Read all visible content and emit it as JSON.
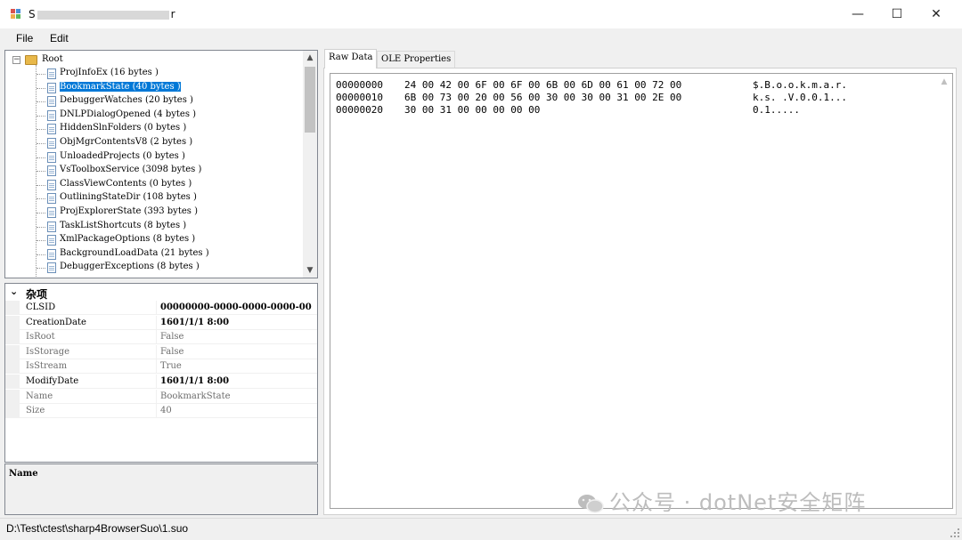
{
  "window": {
    "title_prefix": "S",
    "title_suffix": "r",
    "minimize": "—",
    "maximize": "☐",
    "close": "✕"
  },
  "menu": {
    "file": "File",
    "edit": "Edit"
  },
  "tree": {
    "root": "Root",
    "items": [
      {
        "label": "ProjInfoEx (16 bytes )"
      },
      {
        "label": "BookmarkState (40 bytes )"
      },
      {
        "label": "DebuggerWatches (20 bytes )"
      },
      {
        "label": "DNLPDialogOpened (4 bytes )"
      },
      {
        "label": "HiddenSlnFolders (0 bytes )"
      },
      {
        "label": "ObjMgrContentsV8 (2 bytes )"
      },
      {
        "label": "UnloadedProjects (0 bytes )"
      },
      {
        "label": "VsToolboxService (3098 bytes )"
      },
      {
        "label": "ClassViewContents (0 bytes )"
      },
      {
        "label": "OutliningStateDir (108 bytes )"
      },
      {
        "label": "ProjExplorerState (393 bytes )"
      },
      {
        "label": "TaskListShortcuts (8 bytes )"
      },
      {
        "label": "XmlPackageOptions (8 bytes )"
      },
      {
        "label": "BackgroundLoadData (21 bytes )"
      },
      {
        "label": "DebuggerExceptions (8 bytes )"
      }
    ],
    "selected": "BookmarkState (40 bytes )"
  },
  "properties": {
    "category": "杂项",
    "rows": [
      {
        "name": "CLSID",
        "value": "00000000-0000-0000-0000-00",
        "readonly": false
      },
      {
        "name": "CreationDate",
        "value": "1601/1/1 8:00",
        "readonly": false
      },
      {
        "name": "IsRoot",
        "value": "False",
        "readonly": true
      },
      {
        "name": "IsStorage",
        "value": "False",
        "readonly": true
      },
      {
        "name": "IsStream",
        "value": "True",
        "readonly": true
      },
      {
        "name": "ModifyDate",
        "value": "1601/1/1 8:00",
        "readonly": false
      },
      {
        "name": "Name",
        "value": "BookmarkState",
        "readonly": true
      },
      {
        "name": "Size",
        "value": "40",
        "readonly": true
      }
    ],
    "description_title": "Name"
  },
  "tabs": {
    "raw": "Raw Data",
    "ole": "OLE Properties",
    "active": "Raw Data"
  },
  "hex": {
    "rows": [
      {
        "offset": "00000000",
        "bytes": "24 00 42 00 6F 00 6F 00 6B 00 6D 00 61 00 72 00",
        "ascii": "$.B.o.o.k.m.a.r."
      },
      {
        "offset": "00000010",
        "bytes": "6B 00 73 00 20 00 56 00 30 00 30 00 31 00 2E 00",
        "ascii": "k.s. .V.0.0.1..."
      },
      {
        "offset": "00000020",
        "bytes": "30 00 31 00 00 00 00 00",
        "ascii": "0.1....."
      }
    ]
  },
  "status": {
    "path": "D:\\Test\\ctest\\sharp4BrowserSuo\\1.suo"
  },
  "watermark": {
    "text": "公众号 · dotNet安全矩阵"
  },
  "colors": {
    "selection": "#0078d7",
    "panel": "#f0f0f0",
    "border": "#828790"
  }
}
